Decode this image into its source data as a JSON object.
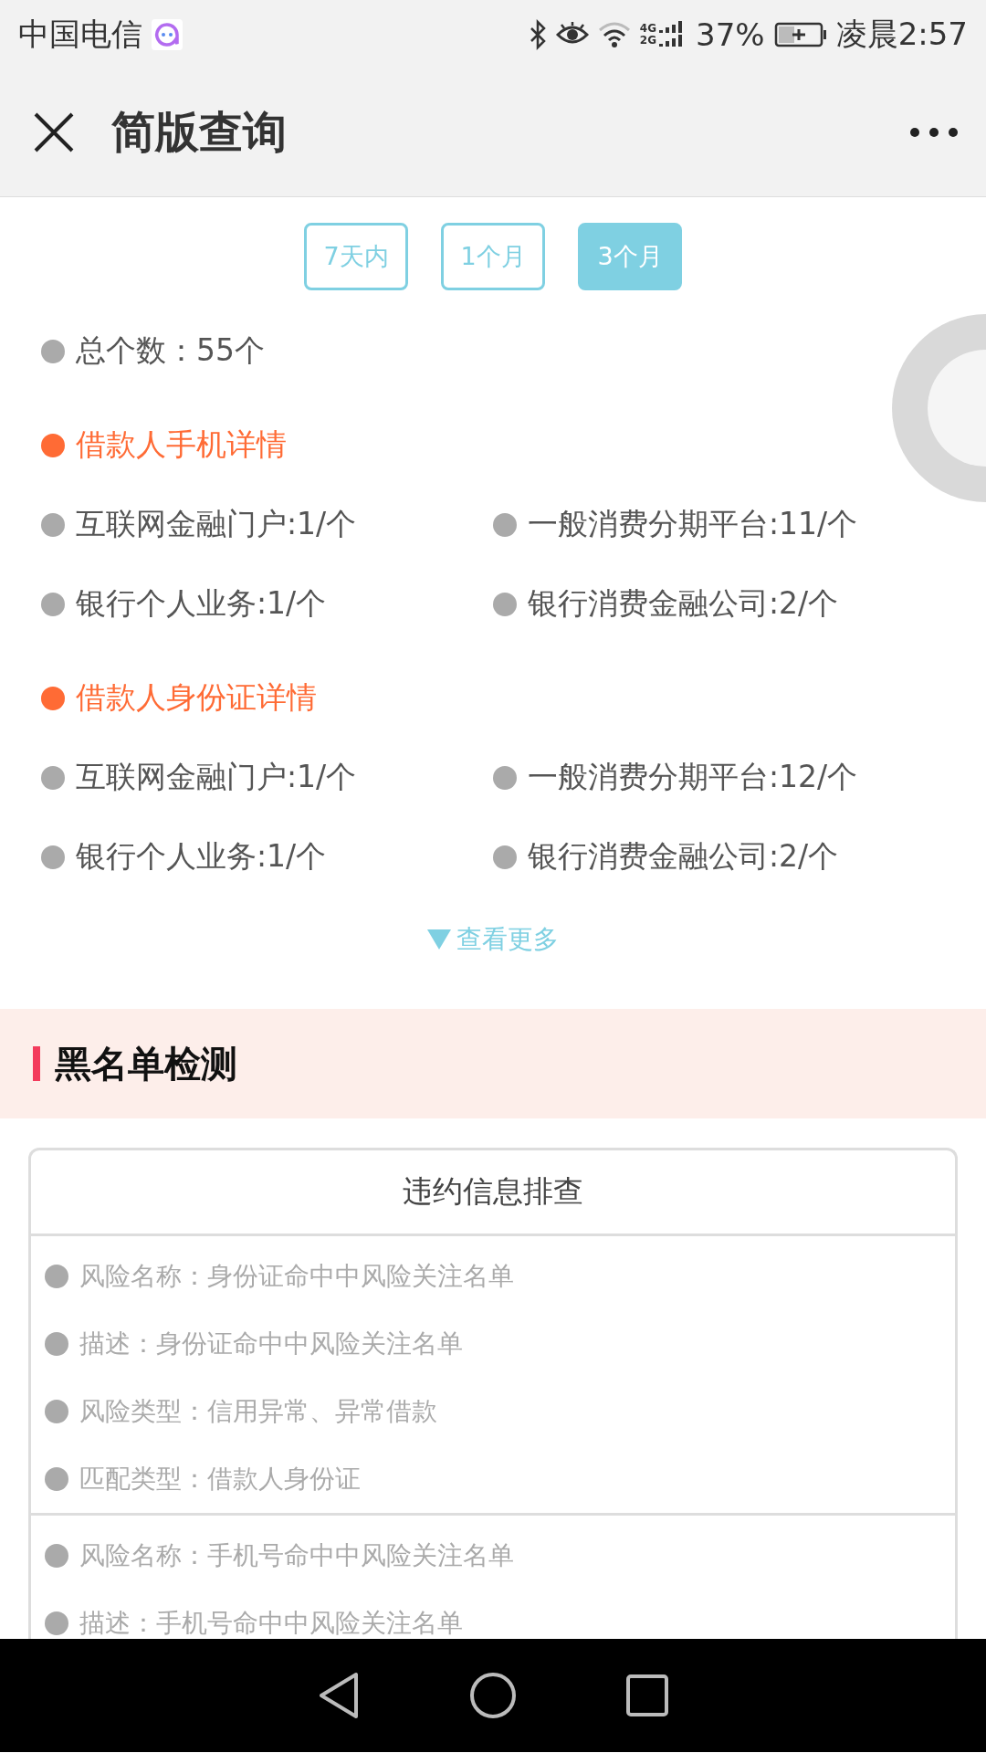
{
  "status_bar": {
    "carrier": "中国电信",
    "network": [
      "4G",
      "2G"
    ],
    "battery": "37%",
    "time": "凌晨2:57"
  },
  "header": {
    "title": "简版查询"
  },
  "periods": [
    {
      "label": "7天内",
      "selected": false
    },
    {
      "label": "1个月",
      "selected": false
    },
    {
      "label": "3个月",
      "selected": true
    }
  ],
  "total": "总个数：55个",
  "sections": [
    {
      "title": "借款人手机详情",
      "items": [
        "互联网金融门户:1/个",
        "一般消费分期平台:11/个",
        "银行个人业务:1/个",
        "银行消费金融公司:2/个"
      ]
    },
    {
      "title": "借款人身份证详情",
      "items": [
        "互联网金融门户:1/个",
        "一般消费分期平台:12/个",
        "银行个人业务:1/个",
        "银行消费金融公司:2/个"
      ]
    }
  ],
  "more_link": "查看更多",
  "blacklist": {
    "title": "黑名单检测",
    "card_title": "违约信息排查",
    "records": [
      {
        "lines": [
          "风险名称：身份证命中中风险关注名单",
          "描述：身份证命中中风险关注名单",
          "风险类型：信用异常、异常借款",
          "匹配类型：借款人身份证"
        ]
      },
      {
        "lines": [
          "风险名称：手机号命中中风险关注名单",
          "描述：手机号命中中风险关注名单"
        ]
      }
    ]
  }
}
